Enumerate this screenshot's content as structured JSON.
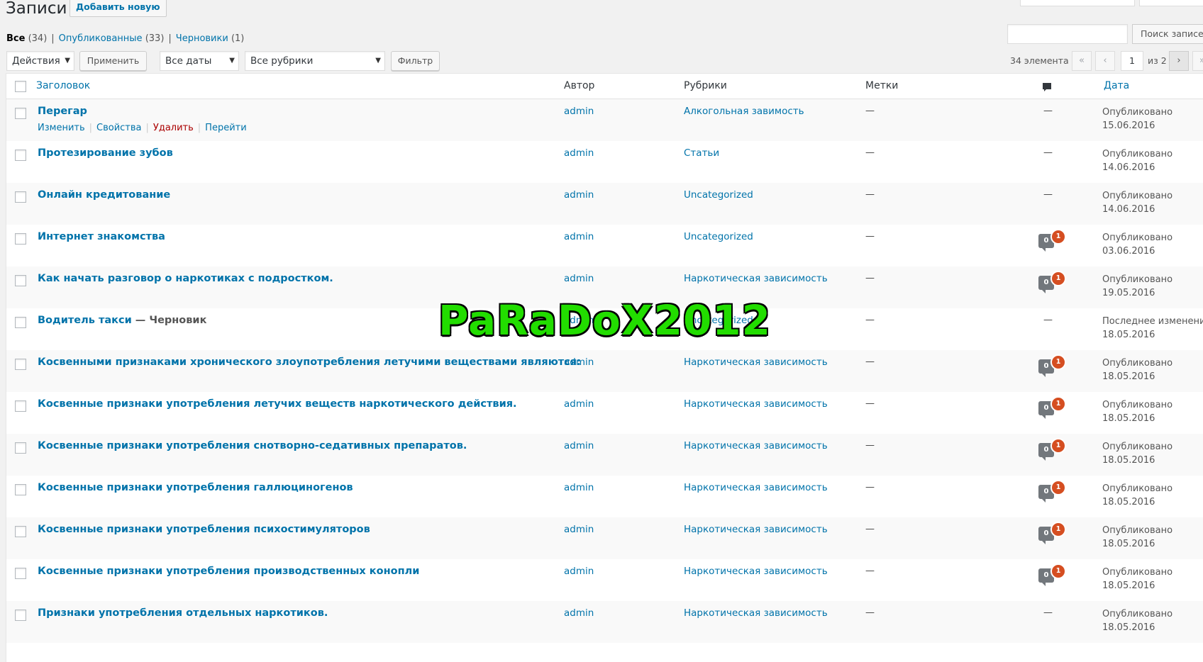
{
  "header": {
    "page_title": "Записи",
    "add_new_label": "Добавить новую"
  },
  "filters": {
    "all_label": "Все",
    "all_count": "(34)",
    "published_label": "Опубликованные",
    "published_count": "(33)",
    "drafts_label": "Черновики",
    "drafts_count": "(1)"
  },
  "search": {
    "button_label": "Поиск записей",
    "placeholder": ""
  },
  "toolbar": {
    "bulk_actions": "Действия",
    "apply_label": "Применить",
    "dates": "Все даты",
    "categories": "Все рубрики",
    "filter_label": "Фильтр"
  },
  "pagination": {
    "items_count": "34 элемента",
    "first": "«",
    "prev": "‹",
    "current_page": "1",
    "of_pages": "из 2",
    "next": "›",
    "last": "»"
  },
  "table": {
    "columns": {
      "title": "Заголовок",
      "author": "Автор",
      "categories": "Рубрики",
      "tags": "Метки",
      "date": "Дата"
    },
    "row_actions": {
      "edit": "Изменить",
      "quick_edit": "Свойства",
      "trash": "Удалить",
      "view": "Перейти"
    },
    "rows": [
      {
        "title": "Перегар",
        "state": "",
        "author": "admin",
        "category": "Алкогольная завимость",
        "tags": "—",
        "comments": "—",
        "pending": "",
        "date_status": "Опубликовано",
        "date": "15.06.2016"
      },
      {
        "title": "Протезирование зубов",
        "state": "",
        "author": "admin",
        "category": "Статьи",
        "tags": "—",
        "comments": "—",
        "pending": "",
        "date_status": "Опубликовано",
        "date": "14.06.2016"
      },
      {
        "title": "Онлайн кредитование",
        "state": "",
        "author": "admin",
        "category": "Uncategorized",
        "tags": "—",
        "comments": "—",
        "pending": "",
        "date_status": "Опубликовано",
        "date": "14.06.2016"
      },
      {
        "title": "Интернет знакомства",
        "state": "",
        "author": "admin",
        "category": "Uncategorized",
        "tags": "—",
        "comments": "0",
        "pending": "1",
        "date_status": "Опубликовано",
        "date": "03.06.2016"
      },
      {
        "title": "Как начать разговор о наркотиках с подростком.",
        "state": "",
        "author": "admin",
        "category": "Наркотическая зависимость",
        "tags": "—",
        "comments": "0",
        "pending": "1",
        "date_status": "Опубликовано",
        "date": "19.05.2016"
      },
      {
        "title": "Водитель такси",
        "state": " — Черновик",
        "author": "admin",
        "category": "Uncategorized",
        "tags": "—",
        "comments": "—",
        "pending": "",
        "date_status": "Последнее изменение",
        "date": "18.05.2016"
      },
      {
        "title": "Косвенными признаками хронического злоупотребления летучими веществами являются:",
        "state": "",
        "author": "admin",
        "category": "Наркотическая зависимость",
        "tags": "—",
        "comments": "0",
        "pending": "1",
        "date_status": "Опубликовано",
        "date": "18.05.2016"
      },
      {
        "title": "Косвенные признаки употребления летучих веществ наркотического действия.",
        "state": "",
        "author": "admin",
        "category": "Наркотическая зависимость",
        "tags": "—",
        "comments": "0",
        "pending": "1",
        "date_status": "Опубликовано",
        "date": "18.05.2016"
      },
      {
        "title": "Косвенные признаки употребления снотворно-седативных препаратов.",
        "state": "",
        "author": "admin",
        "category": "Наркотическая зависимость",
        "tags": "—",
        "comments": "0",
        "pending": "1",
        "date_status": "Опубликовано",
        "date": "18.05.2016"
      },
      {
        "title": "Косвенные признаки употребления галлюциногенов",
        "state": "",
        "author": "admin",
        "category": "Наркотическая зависимость",
        "tags": "—",
        "comments": "0",
        "pending": "1",
        "date_status": "Опубликовано",
        "date": "18.05.2016"
      },
      {
        "title": "Косвенные признаки употребления психостимуляторов",
        "state": "",
        "author": "admin",
        "category": "Наркотическая зависимость",
        "tags": "—",
        "comments": "0",
        "pending": "1",
        "date_status": "Опубликовано",
        "date": "18.05.2016"
      },
      {
        "title": "Косвенные признаки употребления производственных конопли",
        "state": "",
        "author": "admin",
        "category": "Наркотическая зависимость",
        "tags": "—",
        "comments": "0",
        "pending": "1",
        "date_status": "Опубликовано",
        "date": "18.05.2016"
      },
      {
        "title": "Признаки употребления отдельных наркотиков.",
        "state": "",
        "author": "admin",
        "category": "Наркотическая зависимость",
        "tags": "—",
        "comments": "—",
        "pending": "",
        "date_status": "Опубликовано",
        "date": "18.05.2016"
      }
    ]
  },
  "watermark": "PaRaDoX2012"
}
